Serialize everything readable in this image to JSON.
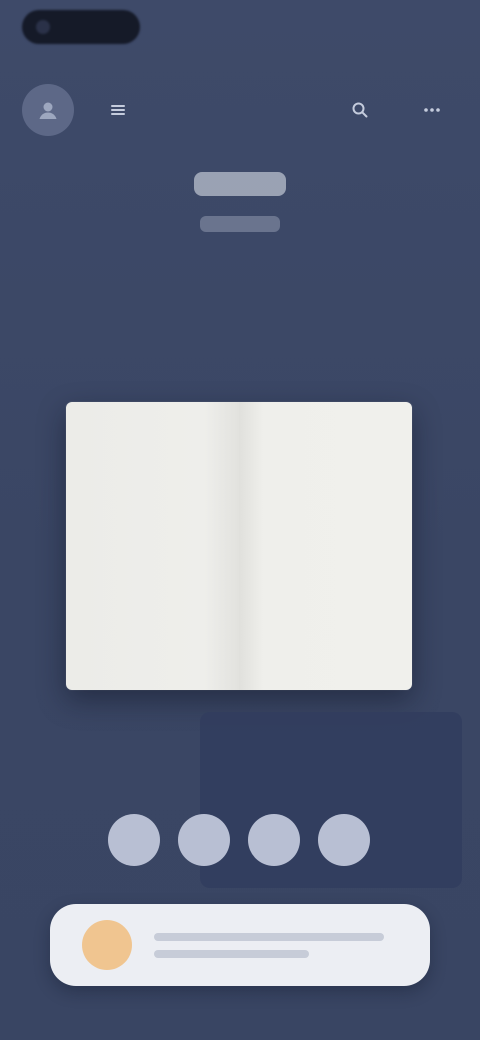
{
  "header": {
    "title": "",
    "subtitle": ""
  },
  "toolbar": {
    "avatar_icon": "user-icon",
    "menu_icon": "menu-icon",
    "search_icon": "search-icon",
    "more_icon": "more-icon"
  },
  "actions": [
    {
      "icon": "action-icon-1"
    },
    {
      "icon": "action-icon-2"
    },
    {
      "icon": "action-icon-3"
    },
    {
      "icon": "action-icon-4"
    }
  ],
  "colors": {
    "background": "#3b4766",
    "page": "#eeeeea",
    "action_button": "#b8bfd3",
    "card": "#eceef3",
    "card_thumb": "#f0c590",
    "dark_panel": "#323d5e"
  }
}
